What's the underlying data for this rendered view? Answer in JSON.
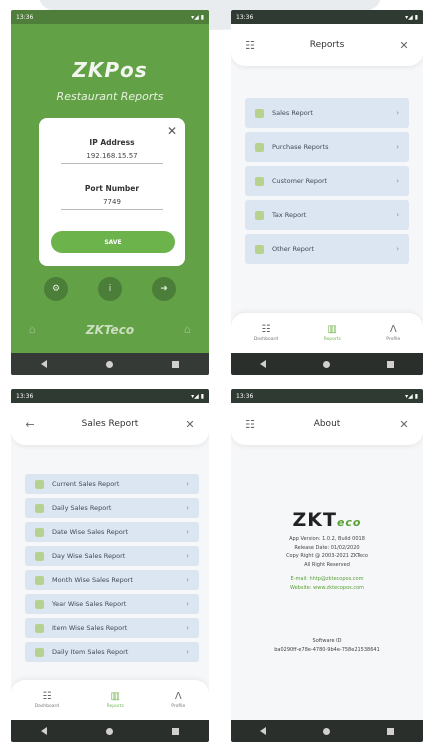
{
  "status": {
    "time": "13:36",
    "signal": "▾◢ ▮"
  },
  "login": {
    "brand": "ZKPos",
    "subtitle": "Restaurant Reports",
    "dialog": {
      "ip_label": "IP Address",
      "ip_value": "192.168.15.57",
      "port_label": "Port Number",
      "port_value": "7749",
      "save_label": "SAVE",
      "close_glyph": "✕"
    },
    "buttons": {
      "settings_glyph": "⚙",
      "info_glyph": "i",
      "next_glyph": "➜"
    },
    "footer_logo": "ZKTeco"
  },
  "reports": {
    "title": "Reports",
    "menu_glyph": "☷",
    "close_glyph": "✕",
    "items": [
      {
        "label": "Sales Report"
      },
      {
        "label": "Purchase Reports"
      },
      {
        "label": "Customer Report"
      },
      {
        "label": "Tax Report"
      },
      {
        "label": "Other Report"
      }
    ],
    "arrow_glyph": "›"
  },
  "sales_report": {
    "title": "Sales Report",
    "back_glyph": "←",
    "close_glyph": "✕",
    "items": [
      {
        "label": "Current Sales Report"
      },
      {
        "label": "Daily Sales Report"
      },
      {
        "label": "Date Wise Sales Report"
      },
      {
        "label": "Day Wise Sales Report"
      },
      {
        "label": "Month Wise Sales Report"
      },
      {
        "label": "Year Wise Sales Report"
      },
      {
        "label": "Item Wise Sales Report"
      },
      {
        "label": "Daily Item Sales Report"
      }
    ]
  },
  "bottom_nav": {
    "items": [
      {
        "label": "Dashboard",
        "glyph": "☷"
      },
      {
        "label": "Reports",
        "glyph": "▥"
      },
      {
        "label": "Profile",
        "glyph": "Ʌ"
      }
    ]
  },
  "about": {
    "title": "About",
    "menu_glyph": "☷",
    "close_glyph": "✕",
    "logo": "ZKT",
    "logo_eco": "eco",
    "version": "App Version: 1.0.2, Build 0018",
    "release": "Release Date: 01/02/2020",
    "copyright": "Copy Right @ 2003-2021 ZKTeco",
    "rights": "All Right Reserved",
    "email": "E-mail: hhtp@zktecopos.com",
    "website": "Website: www.zktecopos.com",
    "software_id_label": "Software ID",
    "software_id": "ba0290ff-e78e-4780-9b4e-758e21538641"
  },
  "colors": {
    "green": "#63a146",
    "accent": "#78b456",
    "item_bg": "#dce5f2"
  }
}
